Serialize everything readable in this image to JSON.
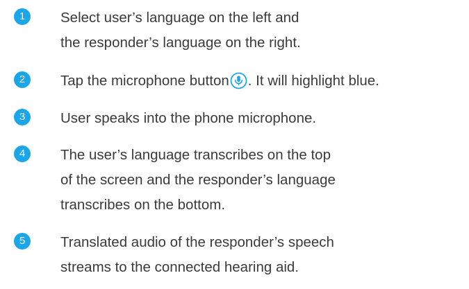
{
  "accent_color": "#1aa6e8",
  "steps": [
    {
      "number": "1",
      "lines": [
        "Select user’s language on the left and",
        "the responder’s language on the right."
      ]
    },
    {
      "number": "2",
      "text_before": "Tap the microphone button",
      "icon": "microphone-icon",
      "text_after": ". It will highlight blue."
    },
    {
      "number": "3",
      "lines": [
        "User speaks into the phone microphone."
      ]
    },
    {
      "number": "4",
      "lines": [
        "The user’s language transcribes on the top",
        "of the screen and the responder’s language",
        "transcribes on the bottom."
      ]
    },
    {
      "number": "5",
      "lines": [
        "Translated audio of the responder’s speech",
        "streams to the connected hearing aid."
      ]
    }
  ]
}
